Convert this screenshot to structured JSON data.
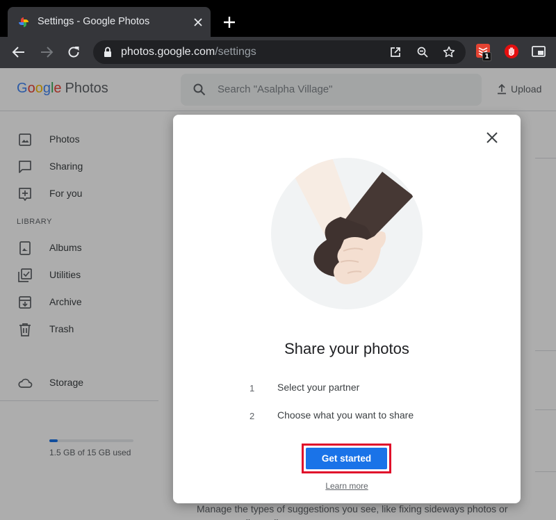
{
  "browser": {
    "tab_title": "Settings - Google Photos",
    "url_host": "photos.google.com",
    "url_path": "/settings",
    "extension_badge": "1"
  },
  "header": {
    "logo_google": [
      "G",
      "o",
      "o",
      "g",
      "l",
      "e"
    ],
    "logo_product": "Photos",
    "search_placeholder": "Search \"Asalpha Village\"",
    "upload_label": "Upload"
  },
  "sidebar": {
    "items": [
      {
        "label": "Photos",
        "icon": "image-icon"
      },
      {
        "label": "Sharing",
        "icon": "chat-icon"
      },
      {
        "label": "For you",
        "icon": "for-you-icon"
      }
    ],
    "library_heading": "LIBRARY",
    "library_items": [
      {
        "label": "Albums",
        "icon": "album-icon"
      },
      {
        "label": "Utilities",
        "icon": "utilities-icon"
      },
      {
        "label": "Archive",
        "icon": "archive-icon"
      },
      {
        "label": "Trash",
        "icon": "trash-icon"
      }
    ],
    "storage": {
      "label": "Storage",
      "usage_text": "1.5 GB of 15 GB used",
      "used_fraction": 0.1
    }
  },
  "background": {
    "suggestions_text": "Manage the types of suggestions you see, like fixing sideways photos or recommending collages"
  },
  "dialog": {
    "title": "Share your photos",
    "steps": [
      {
        "num": "1",
        "text": "Select your partner"
      },
      {
        "num": "2",
        "text": "Choose what you want to share"
      }
    ],
    "cta_label": "Get started",
    "learn_more_label": "Learn more"
  },
  "colors": {
    "accent": "#1a73e8",
    "highlight_outline": "#e00b2a",
    "chrome_dark": "#35363a"
  }
}
